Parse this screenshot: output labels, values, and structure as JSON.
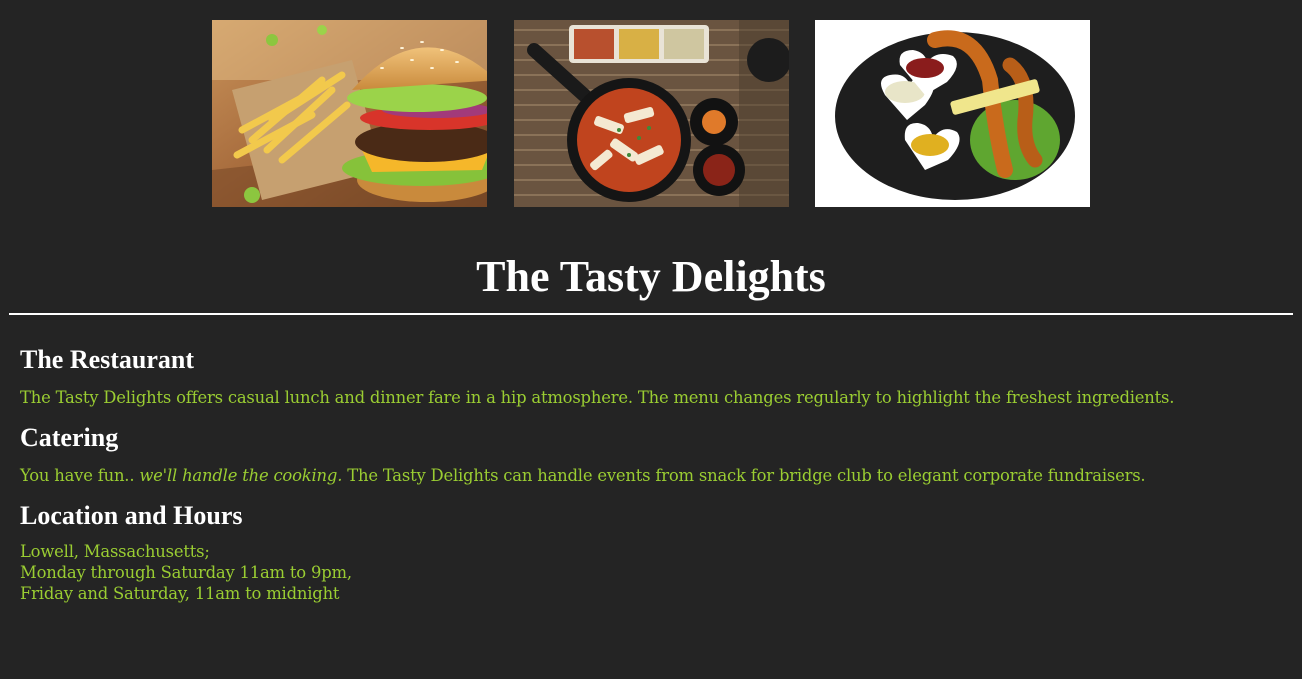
{
  "colors": {
    "background": "#242424",
    "heading": "#ffffff",
    "body_text": "#9acd32"
  },
  "gallery": {
    "images": [
      {
        "name": "burger-and-fries-photo"
      },
      {
        "name": "tteokbokki-skillet-photo"
      },
      {
        "name": "sausages-with-dips-photo"
      }
    ]
  },
  "site": {
    "title": "The Tasty Delights"
  },
  "sections": {
    "restaurant": {
      "heading": "The Restaurant",
      "text": "The Tasty Delights offers casual lunch and dinner fare in a hip atmosphere. The menu changes regularly to highlight the freshest ingredients."
    },
    "catering": {
      "heading": "Catering",
      "text_intro": "You have fun.. ",
      "text_emphasis": "we'll handle the cooking.",
      "text_rest": " The Tasty Delights can handle events from snack for bridge club to elegant corporate fundraisers."
    },
    "location": {
      "heading": "Location and Hours",
      "lines": [
        "Lowell, Massachusetts;",
        "Monday through Saturday 11am to 9pm,",
        "Friday and Saturday, 11am to midnight"
      ]
    }
  }
}
